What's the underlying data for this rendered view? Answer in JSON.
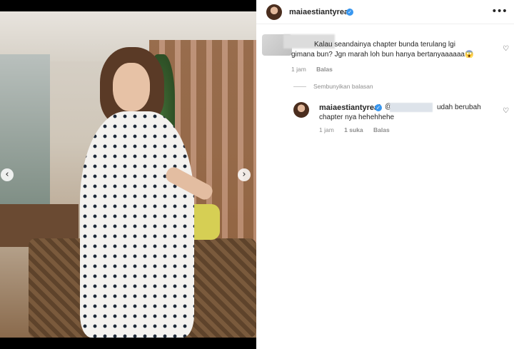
{
  "post": {
    "username": "maiaestiantyreal",
    "more_icon": "more-horizontal-icon"
  },
  "media": {
    "prev_icon": "chevron-left-icon",
    "next_icon": "chevron-right-icon",
    "prev_glyph": "‹",
    "next_glyph": "›"
  },
  "comments": [
    {
      "text_line1": "Kalau seandainya chapter bunda terulang lgi",
      "text_line2": "gimana bun? Jgn marah loh bun hanya bertanyaaaaaa😱",
      "time": "1 jam",
      "reply_label": "Balas"
    }
  ],
  "hide_replies_label": "Sembunyikan balasan",
  "reply": {
    "username": "maiaestiantyreal",
    "mention_prefix": "@",
    "text_line1": "udah berubah",
    "text_line2": "chapter nya hehehhehe",
    "time": "1 jam",
    "likes": "1 suka",
    "reply_label": "Balas"
  },
  "colors": {
    "verified": "#3897f0",
    "text": "#262626",
    "muted": "#8e8e8e"
  }
}
